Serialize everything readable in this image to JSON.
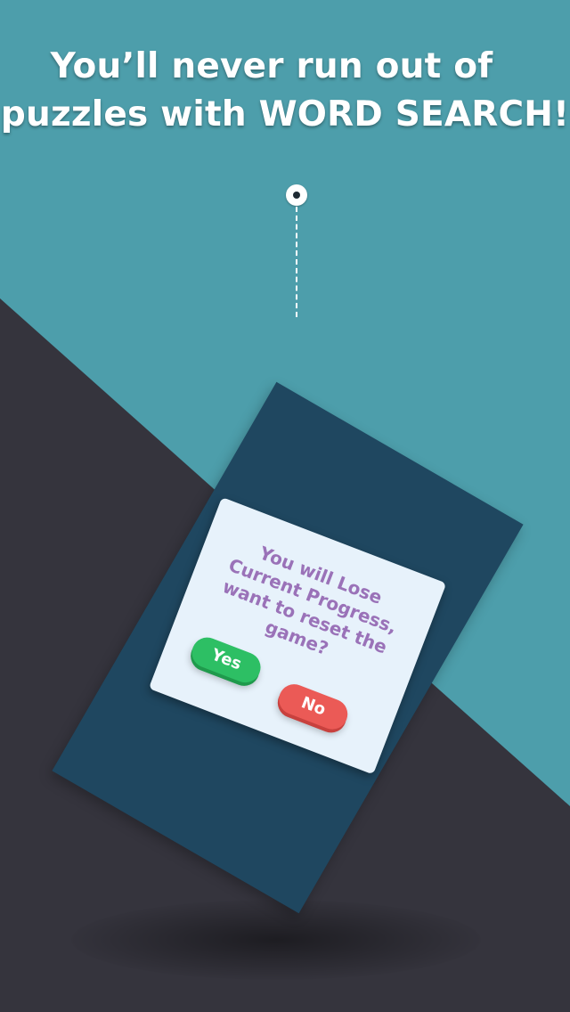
{
  "headline": {
    "line1": "You’ll never run out of",
    "line2": "puzzles with WORD SEARCH!"
  },
  "dialog": {
    "message": "You will Lose Current Progress, want to reset the game?",
    "yes_label": "Yes",
    "no_label": "No"
  },
  "colors": {
    "teal_background": "#4d9eab",
    "dark_background": "#35343d",
    "card": "#1f4760",
    "dialog": "#e7f2fb",
    "message_text": "#9a72b8",
    "yes_button": "#2dbf64",
    "no_button": "#eb5a56"
  },
  "icons": {
    "pin": "hanging-pin-icon"
  }
}
